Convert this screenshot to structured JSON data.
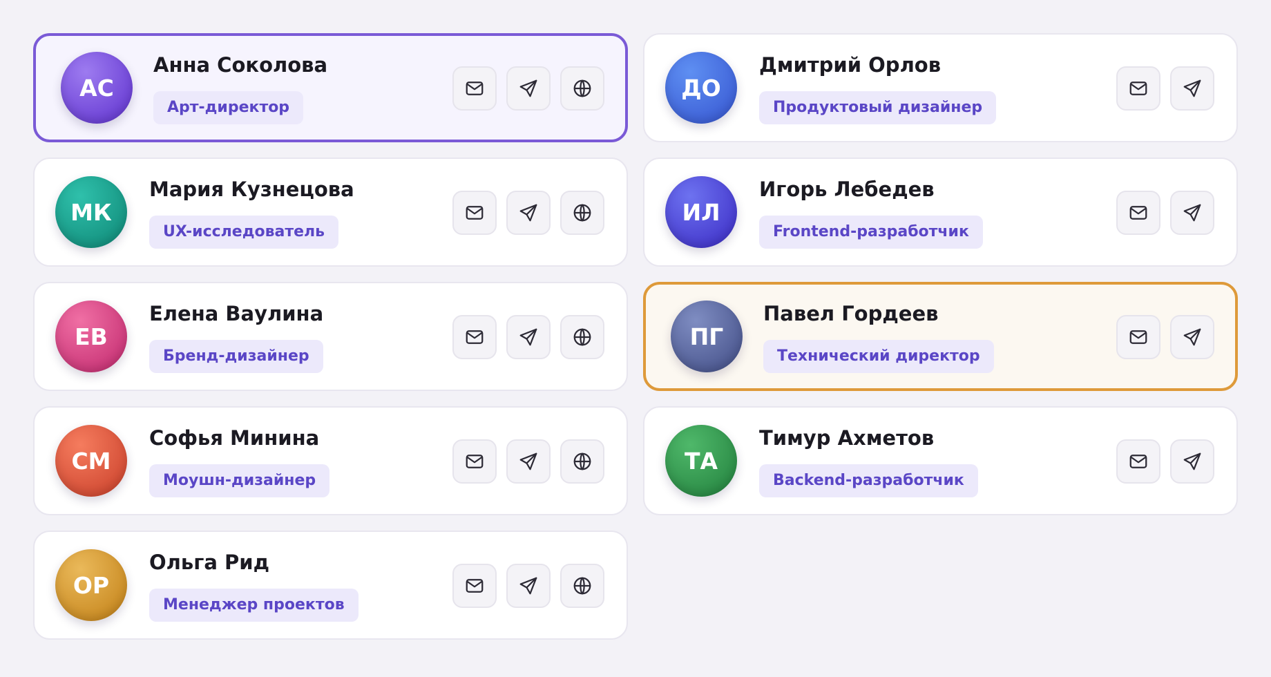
{
  "team": {
    "members": [
      {
        "initials": "АС",
        "name": "Анна Соколова",
        "role": "Арт-директор",
        "gradient": [
          "#9d7bf0",
          "#6a3fd4"
        ],
        "highlight": "purple",
        "actions": [
          "mail-icon",
          "send-icon",
          "globe-icon"
        ]
      },
      {
        "initials": "ДО",
        "name": "Дмитрий Орлов",
        "role": "Продуктовый дизайнер",
        "gradient": [
          "#5e8ff2",
          "#3d5fd6"
        ],
        "highlight": "",
        "actions": [
          "mail-icon",
          "send-icon"
        ]
      },
      {
        "initials": "МК",
        "name": "Мария Кузнецова",
        "role": "UX-исследователь",
        "gradient": [
          "#2fc0ab",
          "#14917f"
        ],
        "highlight": "",
        "actions": [
          "mail-icon",
          "send-icon",
          "globe-icon"
        ]
      },
      {
        "initials": "ИЛ",
        "name": "Игорь Лебедев",
        "role": "Frontend-разработчик",
        "gradient": [
          "#6d72f0",
          "#4438cc"
        ],
        "highlight": "",
        "actions": [
          "mail-icon",
          "send-icon"
        ]
      },
      {
        "initials": "ЕВ",
        "name": "Елена Ваулина",
        "role": "Бренд-дизайнер",
        "gradient": [
          "#f06fa4",
          "#c93577"
        ],
        "highlight": "",
        "actions": [
          "mail-icon",
          "send-icon",
          "globe-icon"
        ]
      },
      {
        "initials": "ПГ",
        "name": "Павел Гордеев",
        "role": "Технический директор",
        "gradient": [
          "#7f8dc2",
          "#4c5890"
        ],
        "highlight": "amber",
        "actions": [
          "mail-icon",
          "send-icon"
        ]
      },
      {
        "initials": "СМ",
        "name": "Софья Минина",
        "role": "Моушн-дизайнер",
        "gradient": [
          "#f57c5e",
          "#d14a33"
        ],
        "highlight": "",
        "actions": [
          "mail-icon",
          "send-icon",
          "globe-icon"
        ]
      },
      {
        "initials": "ТА",
        "name": "Тимур Ахметов",
        "role": "Backend-разработчик",
        "gradient": [
          "#4fb86a",
          "#2a8a45"
        ],
        "highlight": "",
        "actions": [
          "mail-icon",
          "send-icon"
        ]
      },
      {
        "initials": "ОР",
        "name": "Ольга Рид",
        "role": "Менеджер проектов",
        "gradient": [
          "#eab95a",
          "#c98a22"
        ],
        "highlight": "",
        "actions": [
          "mail-icon",
          "send-icon",
          "globe-icon"
        ]
      }
    ]
  },
  "colors": {
    "page_bg": "#f3f2f7",
    "card_border": "#e8e6ef",
    "highlight_purple": "#7a5ad6",
    "highlight_amber": "#de9a3a",
    "role_bg": "#ece9fb",
    "role_text": "#5a46c6"
  }
}
